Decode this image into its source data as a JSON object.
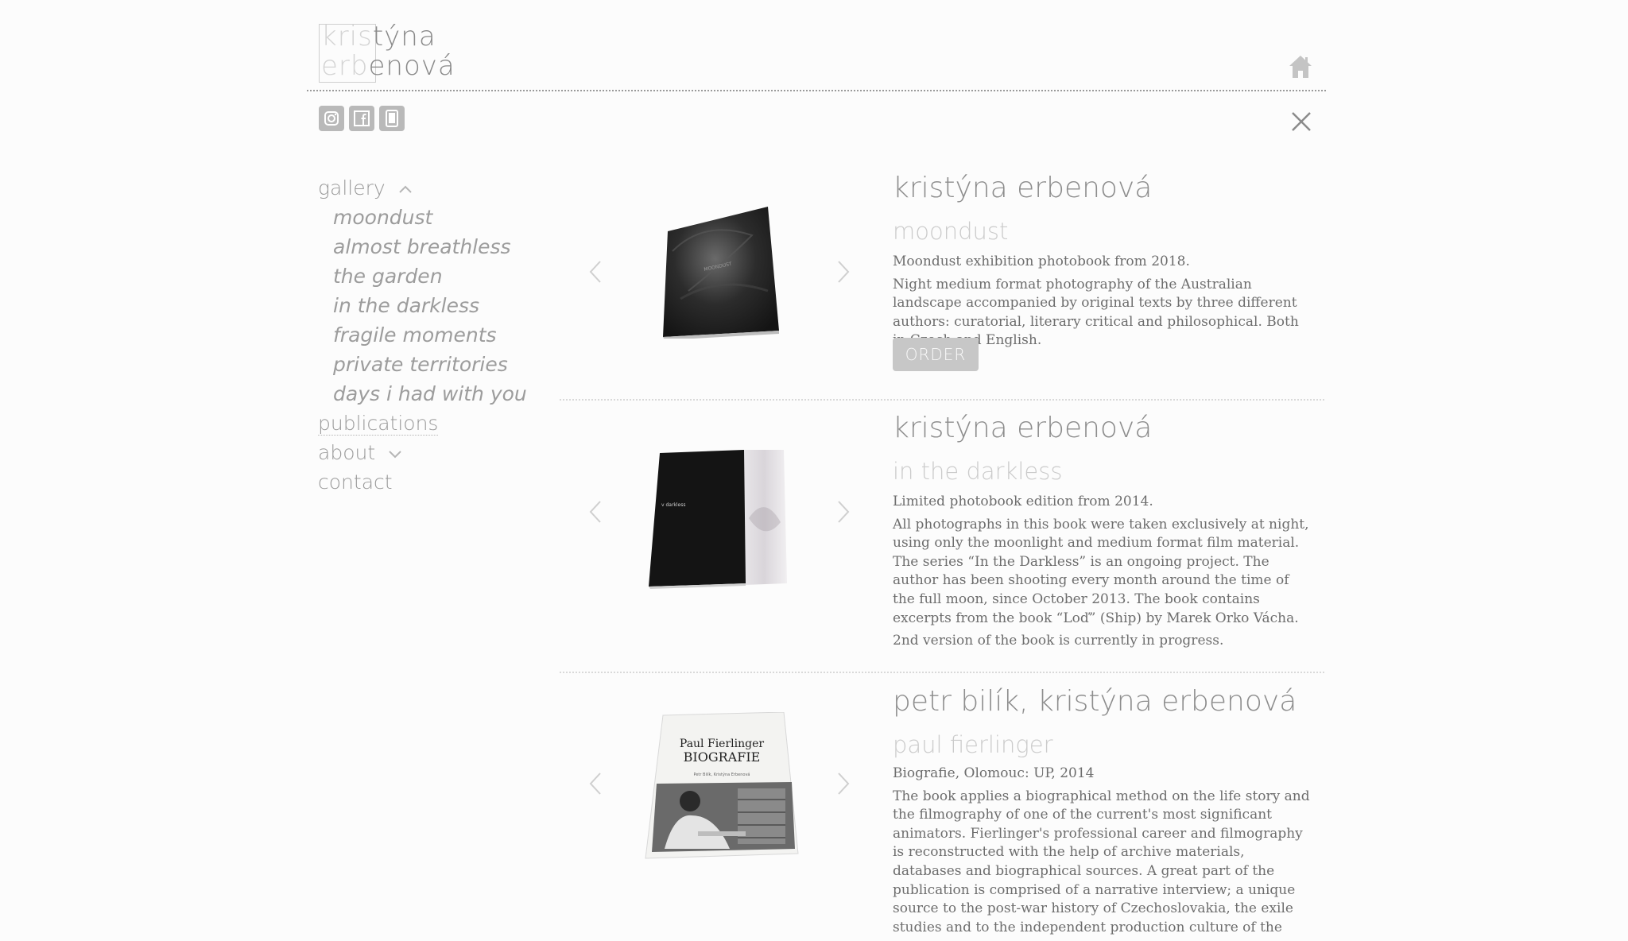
{
  "header": {
    "logo_line1_faded": "kris",
    "logo_line1_rest": "týna",
    "logo_line2_faded": "erb",
    "logo_line2_rest": "enová"
  },
  "nav": {
    "gallery": "gallery",
    "gallery_items": [
      "moondust",
      "almost breathless",
      "the garden",
      "in the darkless",
      "fragile moments",
      "private territories",
      "days i had with you"
    ],
    "publications": "publications",
    "about": "about",
    "contact": "contact"
  },
  "entries": [
    {
      "author": "kristýna erbenová",
      "title": "moondust",
      "subtitle": "Moondust exhibition photobook from 2018.",
      "paragraphs": [
        "Night medium format photography of the Australian landscape accompanied by original texts by three different authors: curatorial, literary critical and philosophical. Both in Czech and English."
      ],
      "order_label": "ORDER"
    },
    {
      "author": "kristýna erbenová",
      "title": "in the darkless",
      "subtitle": "Limited photobook edition from 2014.",
      "paragraphs": [
        "All photographs in this book were taken exclusively at night, using only the moonlight and medium format film material. The series “In the Darkless” is an ongoing project. The author has been shooting every month around the time of the full moon, since October 2013. The book contains excerpts from the book “Loď” (Ship) by Marek Orko Vácha.",
        "2nd version of the book is currently in progress."
      ]
    },
    {
      "author": "petr bilík, kristýna erbenová",
      "title": "paul fierlinger",
      "subtitle": "Biografie, Olomouc: UP, 2014",
      "paragraphs": [
        "The book applies a biographical method on the life story and the filmography of one of the current's most significant animators. Fierlinger's professional career and filmography is reconstructed with the help of archive materials, databases and biographical sources. A great part of the publication is comprised of a narrative interview; a unique source to the post-war history of Czechoslovakia, the exile studies and to the independent production culture of the"
      ],
      "cover_name": "Paul Fierlinger",
      "cover_title": "BIOGRAFIE",
      "cover_authors": "Petr Bilík, Kristýna Erbenová"
    }
  ],
  "book2_spine_text": "v darkless",
  "book1_cover_text": "MOONDUST",
  "colors": {
    "background": "#fcfcfc",
    "nav": "#9a9a9a",
    "button": "#c7c7c7"
  }
}
